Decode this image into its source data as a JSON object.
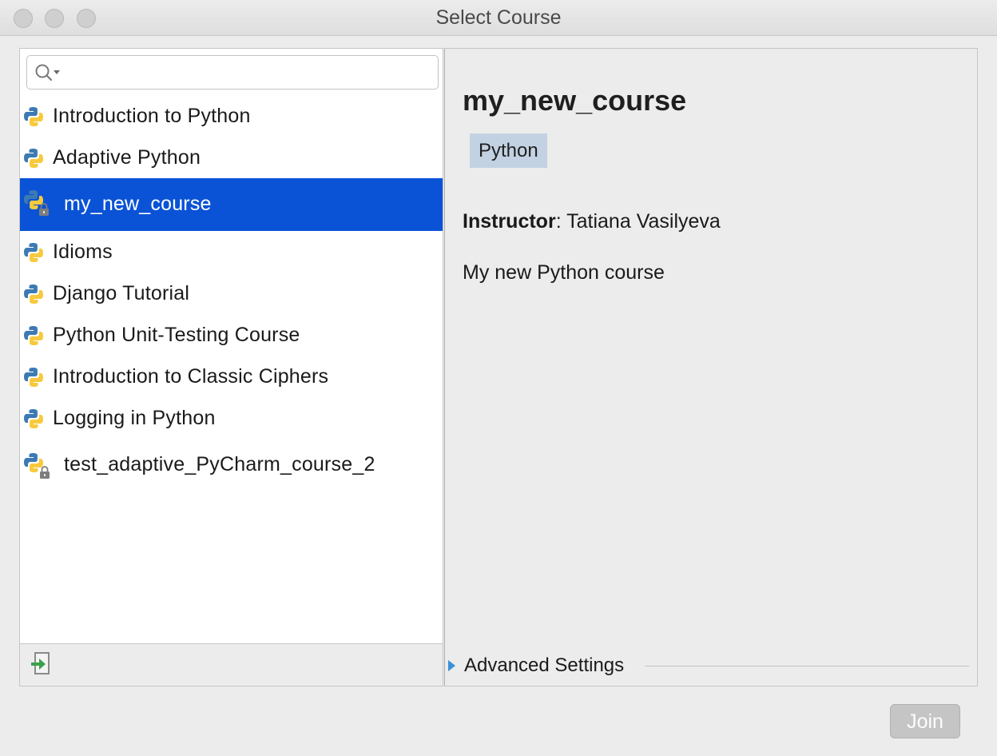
{
  "window": {
    "title": "Select Course"
  },
  "search": {
    "value": "",
    "placeholder": ""
  },
  "courses": [
    {
      "label": "Introduction to Python",
      "locked": false,
      "selected": false
    },
    {
      "label": "Adaptive Python",
      "locked": false,
      "selected": false
    },
    {
      "label": "my_new_course",
      "locked": true,
      "selected": true
    },
    {
      "label": "Idioms",
      "locked": false,
      "selected": false
    },
    {
      "label": "Django Tutorial",
      "locked": false,
      "selected": false
    },
    {
      "label": "Python Unit-Testing Course",
      "locked": false,
      "selected": false
    },
    {
      "label": "Introduction to Classic Ciphers",
      "locked": false,
      "selected": false
    },
    {
      "label": "Logging in Python",
      "locked": false,
      "selected": false
    },
    {
      "label": "test_adaptive_PyCharm_course_2",
      "locked": true,
      "selected": false
    }
  ],
  "details": {
    "title": "my_new_course",
    "tag": "Python",
    "instructor_label": "Instructor",
    "instructor_name": ": Tatiana Vasilyeva",
    "description": "My new Python course",
    "advanced_label": "Advanced Settings"
  },
  "footer": {
    "join_label": "Join"
  },
  "colors": {
    "selection": "#0a53d6",
    "tag_bg": "#c3d2e2",
    "python_blue": "#3d7ab3",
    "python_yellow": "#f7c93c"
  },
  "icons": {
    "course": "python-icon",
    "lock": "lock-icon",
    "import": "import-course-icon",
    "search": "search-icon"
  }
}
